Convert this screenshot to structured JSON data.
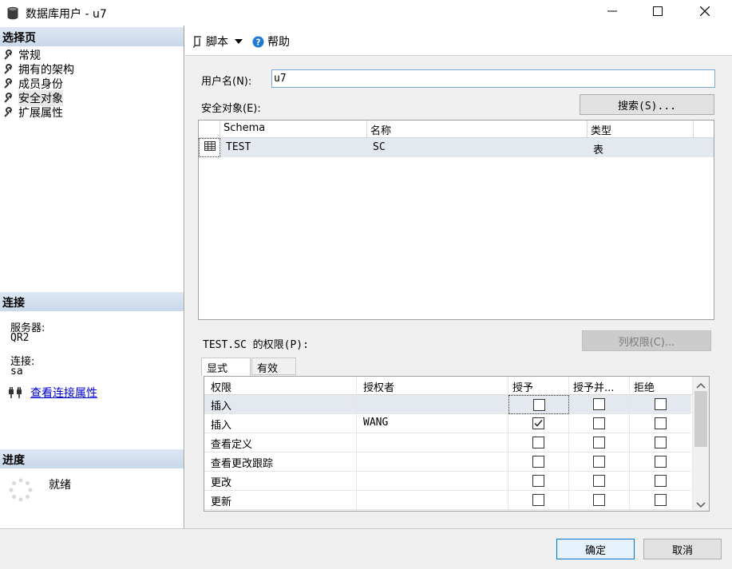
{
  "window": {
    "title": "数据库用户 - u7"
  },
  "left_pane": {
    "select_page_header": "选择页",
    "nav_items": [
      {
        "label": "常规"
      },
      {
        "label": "拥有的架构"
      },
      {
        "label": "成员身份"
      },
      {
        "label": "安全对象"
      },
      {
        "label": "扩展属性"
      }
    ],
    "selected_index": 3,
    "connection_header": "连接",
    "server_label": "服务器:",
    "server_value": "QR2",
    "connection_label": "连接:",
    "connection_value": "sa",
    "view_connection_link": "查看连接属性",
    "progress_header": "进度",
    "progress_status": "就绪"
  },
  "toolbar": {
    "script_label": "脚本",
    "help_label": "帮助"
  },
  "form": {
    "username_label": "用户名(N):",
    "username_value": "u7",
    "securables_label": "安全对象(E):",
    "search_button": "搜索(S)..."
  },
  "securables_table": {
    "columns": [
      "Schema",
      "名称",
      "类型"
    ],
    "rows": [
      {
        "schema": "TEST",
        "name": "SC",
        "type": "表"
      }
    ]
  },
  "permissions": {
    "title": "TEST.SC 的权限(P):",
    "column_permissions_button": "列权限(C)...",
    "tabs": [
      "显式",
      "有效"
    ],
    "active_tab": 0,
    "columns": [
      "权限",
      "授权者",
      "授予",
      "授予并...",
      "拒绝"
    ],
    "rows": [
      {
        "permission": "插入",
        "grantor": "",
        "grant": false,
        "with_grant": false,
        "deny": false
      },
      {
        "permission": "插入",
        "grantor": "WANG",
        "grant": true,
        "with_grant": false,
        "deny": false
      },
      {
        "permission": "查看定义",
        "grantor": "",
        "grant": false,
        "with_grant": false,
        "deny": false
      },
      {
        "permission": "查看更改跟踪",
        "grantor": "",
        "grant": false,
        "with_grant": false,
        "deny": false
      },
      {
        "permission": "更改",
        "grantor": "",
        "grant": false,
        "with_grant": false,
        "deny": false
      },
      {
        "permission": "更新",
        "grantor": "",
        "grant": false,
        "with_grant": false,
        "deny": false
      }
    ]
  },
  "footer": {
    "ok_button": "确定",
    "cancel_button": "取消"
  },
  "colors": {
    "accent": "#0078d7",
    "section_header": "#c8d8ea",
    "link": "#0000cc"
  }
}
